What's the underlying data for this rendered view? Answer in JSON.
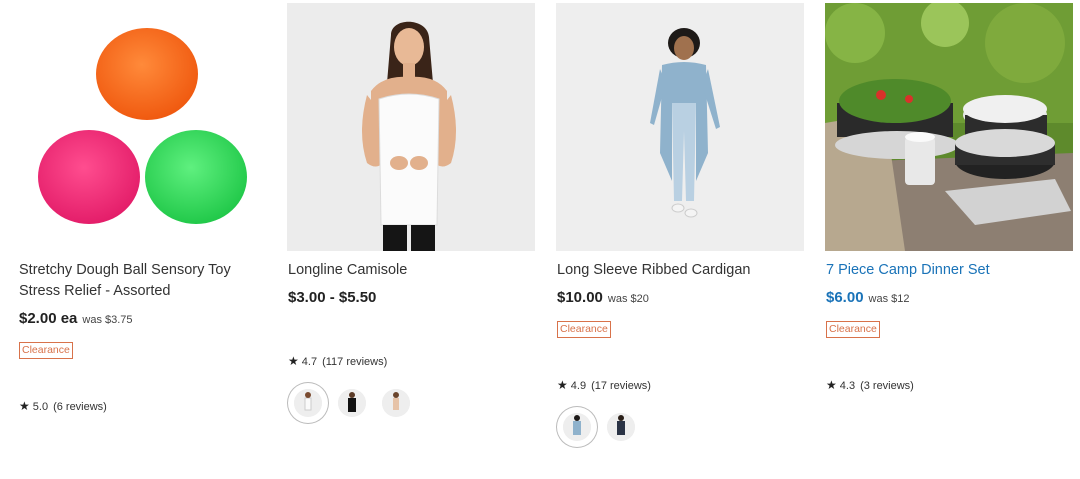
{
  "products": [
    {
      "title": "Stretchy Dough Ball Sensory Toy Stress Relief - Assorted",
      "price": "$2.00 ea",
      "was": "was $3.75",
      "badge": "Clearance",
      "rating": "5.0",
      "reviews": "(6 reviews)"
    },
    {
      "title": "Longline Camisole",
      "price": "$3.00 - $5.50",
      "rating": "4.7",
      "reviews": "(117 reviews)"
    },
    {
      "title": "Long Sleeve Ribbed Cardigan",
      "price": "$10.00",
      "was": "was $20",
      "badge": "Clearance",
      "rating": "4.9",
      "reviews": "(17 reviews)"
    },
    {
      "title": "7 Piece Camp Dinner Set",
      "price": "$6.00",
      "was": "was $12",
      "badge": "Clearance",
      "rating": "4.3",
      "reviews": "(3 reviews)"
    }
  ],
  "icons": {
    "rating": "star-icon"
  },
  "colors": {
    "clearance": "#d8724a",
    "link_blue": "#1a73b8"
  }
}
